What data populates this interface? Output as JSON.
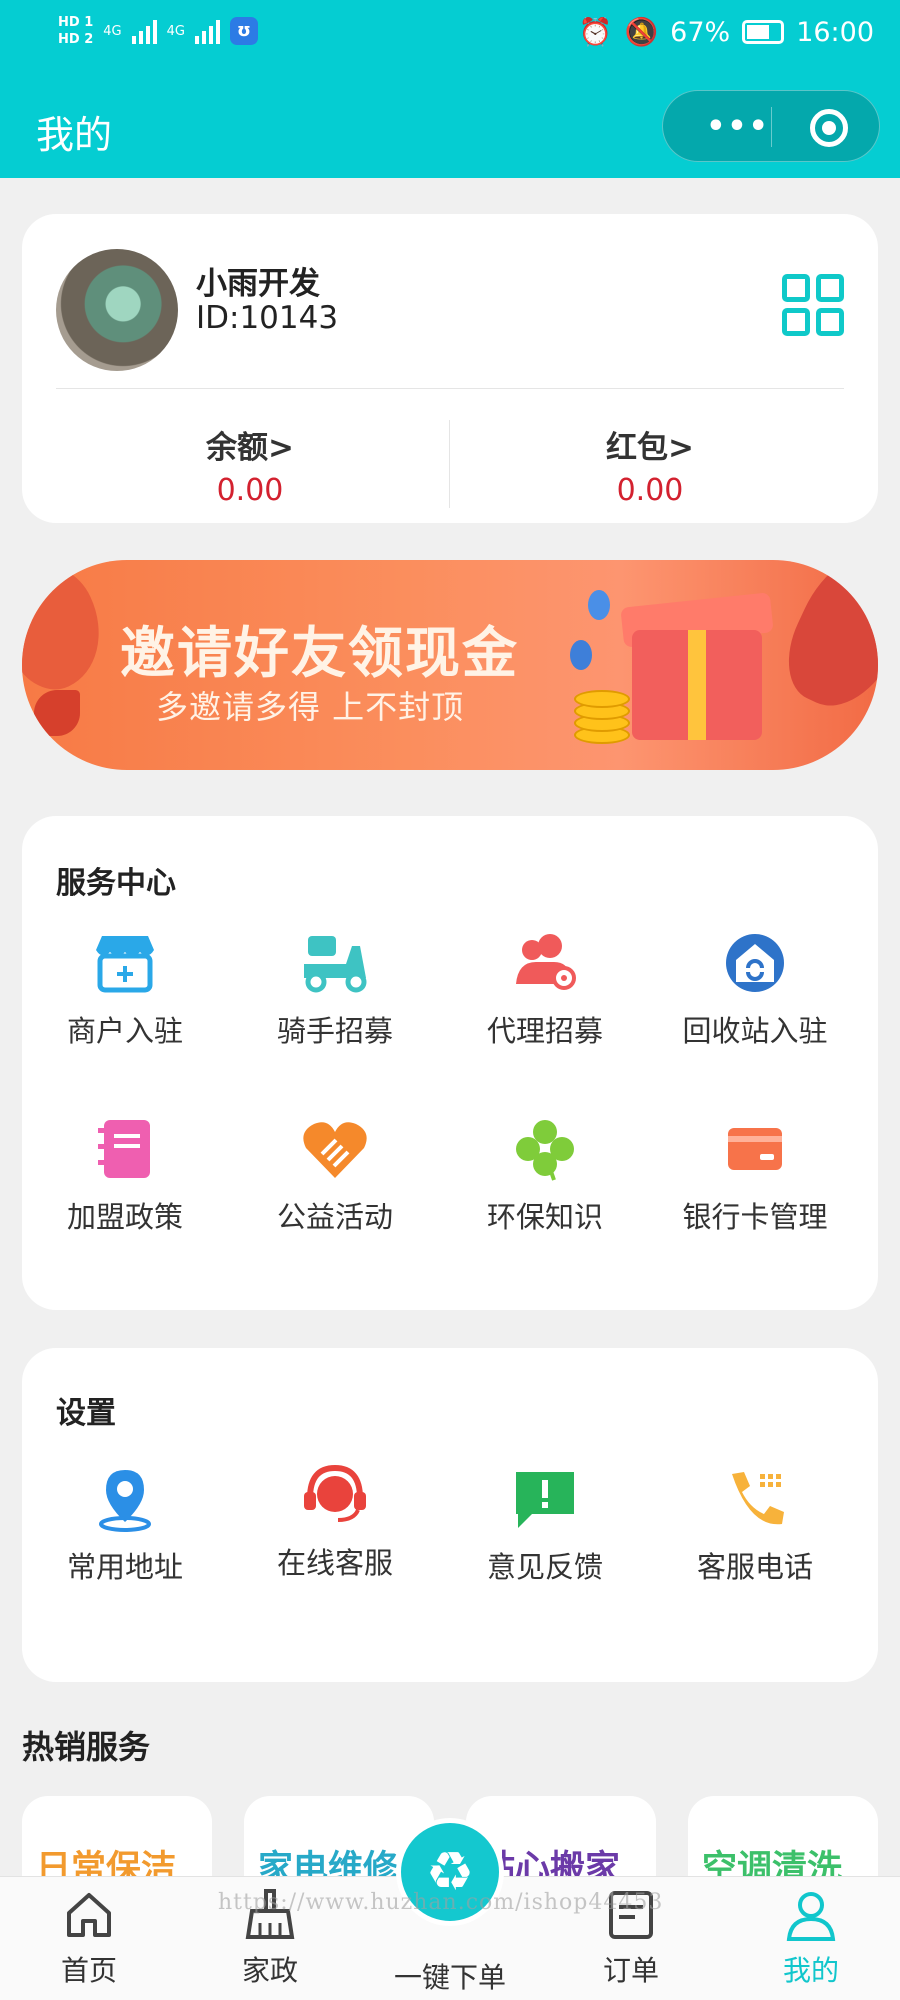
{
  "status_bar": {
    "sim": "HD 1\nHD 2",
    "net1": "4G",
    "net2": "4G",
    "battery": "67%",
    "time": "16:00"
  },
  "nav": {
    "title": "我的",
    "menu_dots": "•••"
  },
  "profile": {
    "name": "小雨开发",
    "id": "ID:10143",
    "balance_label": "余额>",
    "balance_value": "0.00",
    "redpacket_label": "红包>",
    "redpacket_value": "0.00"
  },
  "banner": {
    "title": "邀请好友领现金",
    "subtitle": "多邀请多得 上不封顶"
  },
  "service_center": {
    "title": "服务中心",
    "items": [
      {
        "label": "商户入驻",
        "icon": "shop-icon",
        "color": "#2aa8e8"
      },
      {
        "label": "骑手招募",
        "icon": "scooter-icon",
        "color": "#3ec3c3"
      },
      {
        "label": "代理招募",
        "icon": "agent-icon",
        "color": "#f05a5a"
      },
      {
        "label": "回收站入驻",
        "icon": "recycle-station-icon",
        "color": "#2e73c9"
      },
      {
        "label": "加盟政策",
        "icon": "notebook-icon",
        "color": "#ef5fb0"
      },
      {
        "label": "公益活动",
        "icon": "charity-heart-icon",
        "color": "#f5892b"
      },
      {
        "label": "环保知识",
        "icon": "clover-icon",
        "color": "#7fcc3a"
      },
      {
        "label": "银行卡管理",
        "icon": "bank-card-icon",
        "color": "#f7734a"
      }
    ]
  },
  "settings": {
    "title": "设置",
    "items": [
      {
        "label": "常用地址",
        "icon": "location-pin-icon",
        "color": "#2b8fe6"
      },
      {
        "label": "在线客服",
        "icon": "headset-icon",
        "color": "#e9433c"
      },
      {
        "label": "意见反馈",
        "icon": "feedback-icon",
        "color": "#27b45a"
      },
      {
        "label": "客服电话",
        "icon": "phone-icon",
        "color": "#f7b23b"
      }
    ]
  },
  "hot_services": {
    "title": "热销服务",
    "items": [
      {
        "label": "日常保洁",
        "color": "#f29a2e"
      },
      {
        "label": "家电维修",
        "color": "#27a9c8"
      },
      {
        "label": "贴心搬家",
        "color": "#6b3aa8"
      },
      {
        "label": "空调清洗",
        "color": "#3cc06a"
      }
    ]
  },
  "tabbar": {
    "items": [
      {
        "label": "首页",
        "icon": "home-icon"
      },
      {
        "label": "家政",
        "icon": "broom-icon"
      },
      {
        "label": "一键下单",
        "icon": "recycle-icon"
      },
      {
        "label": "订单",
        "icon": "order-icon"
      },
      {
        "label": "我的",
        "icon": "user-icon",
        "active": true
      }
    ],
    "active_color": "#11c6cc"
  },
  "watermark": "https://www.huzhan.com/ishop44453",
  "colors": {
    "brand": "#05cdd2",
    "money": "#d3212f"
  }
}
